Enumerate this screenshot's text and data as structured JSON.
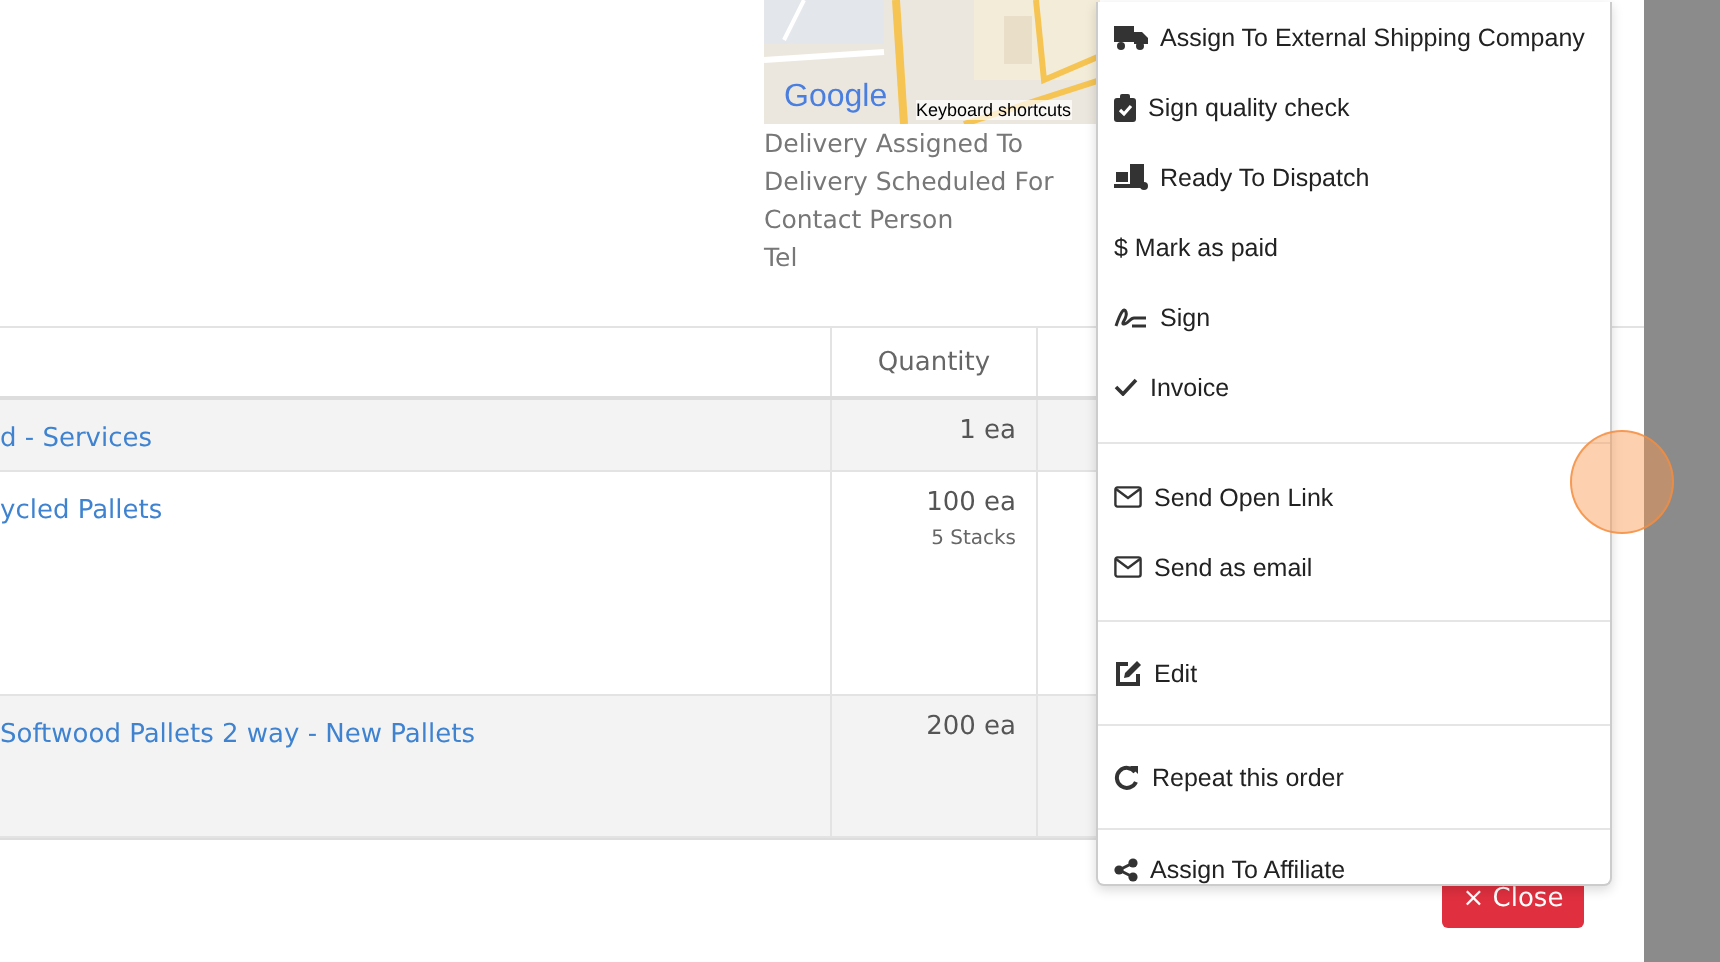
{
  "map": {
    "logo": "Google",
    "shortcuts": "Keyboard shortcuts"
  },
  "delivery_labels": [
    "Delivery Assigned To",
    "Delivery Scheduled For",
    "Contact Person",
    "Tel"
  ],
  "table": {
    "columns": [
      {},
      {
        "label": "Quantity"
      },
      {}
    ],
    "rows": [
      {
        "item": "d - Services",
        "quantity": "1 ea"
      },
      {
        "item": "ycled Pallets",
        "quantity": "100 ea",
        "note": "5 Stacks"
      },
      {
        "item": "Softwood Pallets 2 way - New Pallets",
        "quantity": "200 ea"
      }
    ]
  },
  "close_button": "× Close",
  "menu": {
    "groups": [
      [
        {
          "label": "Assign To External Shipping Company",
          "kind": "truck"
        },
        {
          "label": "Sign quality check",
          "kind": "clipboard"
        },
        {
          "label": "Ready To Dispatch",
          "kind": "dolly"
        },
        {
          "label": "$ Mark as paid",
          "kind": "plain"
        },
        {
          "label": "Sign",
          "kind": "signature"
        },
        {
          "label": "Invoice",
          "kind": "check"
        }
      ],
      [
        {
          "label": "Send Open Link",
          "kind": "envelope"
        },
        {
          "label": "Send as email",
          "kind": "envelope"
        }
      ],
      [
        {
          "label": "Edit",
          "kind": "edit"
        }
      ],
      [
        {
          "label": "Repeat this order",
          "kind": "redo"
        }
      ],
      [
        {
          "label": "Assign To Affiliate",
          "kind": "share"
        }
      ]
    ]
  }
}
